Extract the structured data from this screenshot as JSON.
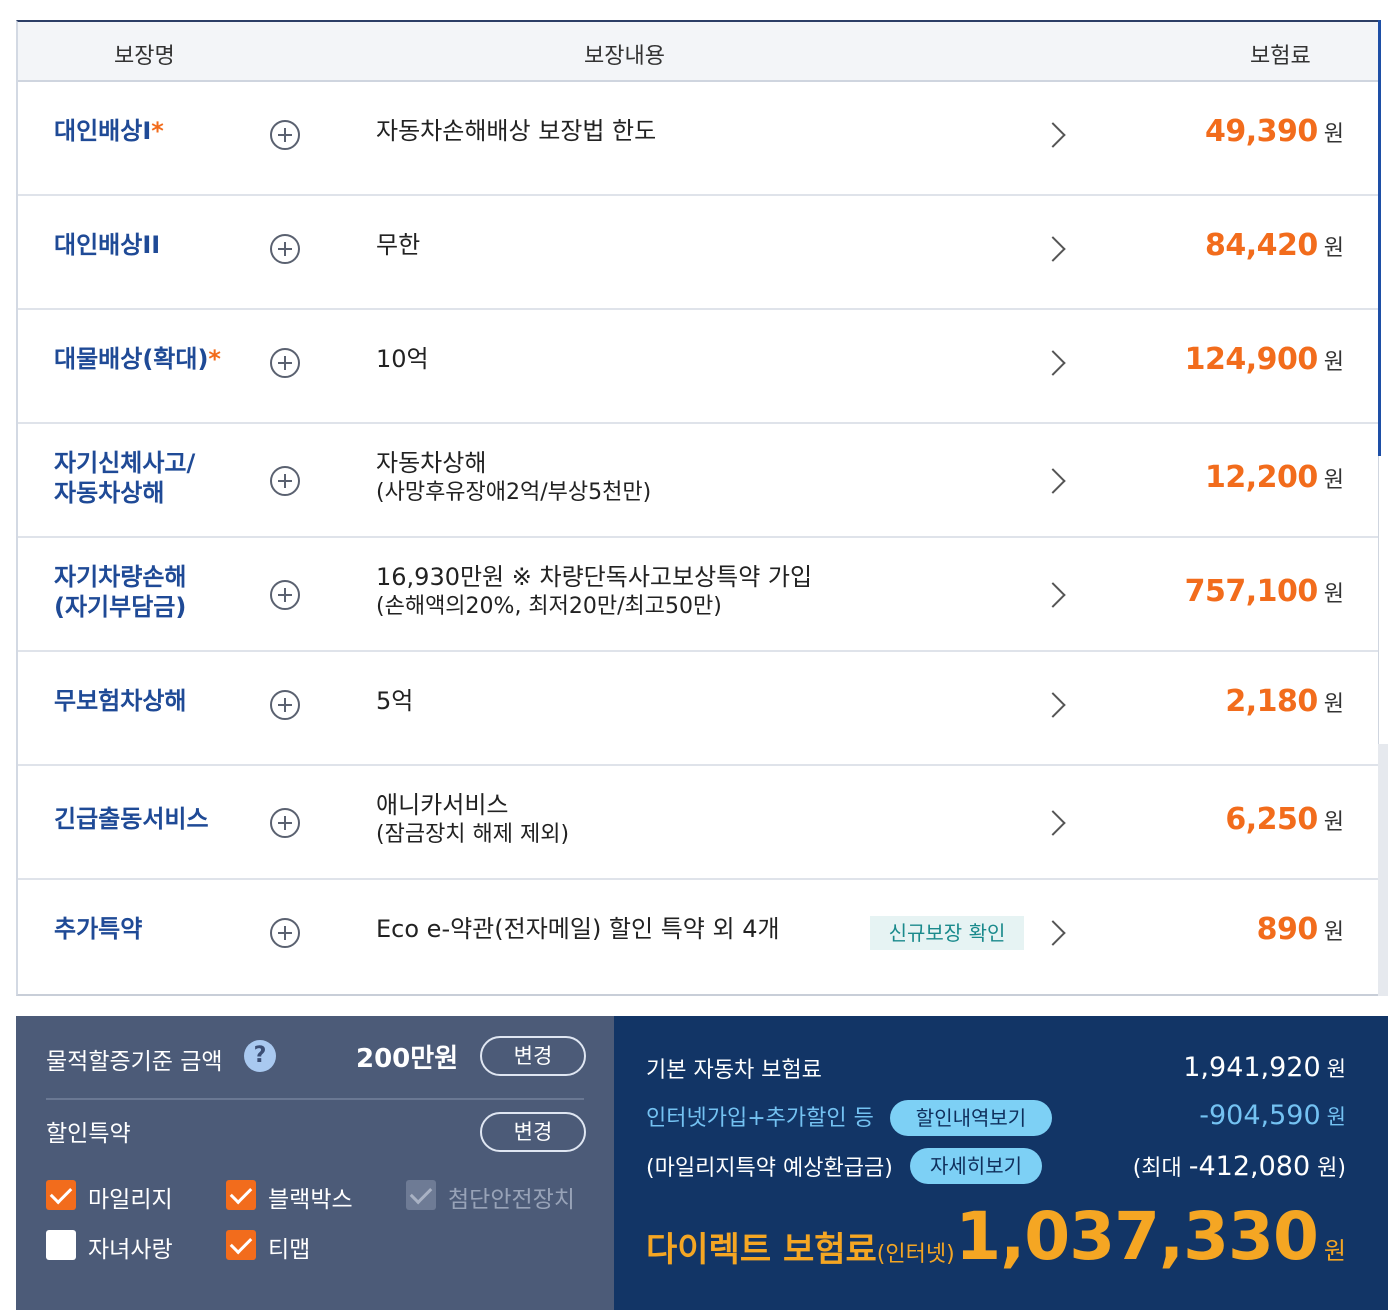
{
  "table": {
    "headers": {
      "name": "보장명",
      "content": "보장내용",
      "price": "보험료"
    },
    "rows": [
      {
        "name": "대인배상I",
        "star": "*",
        "content": "자동차손해배상 보장법 한도",
        "sub": "",
        "badge": "",
        "price": "49,390",
        "unit": "원"
      },
      {
        "name": "대인배상II",
        "star": "",
        "content": "무한",
        "sub": "",
        "badge": "",
        "price": "84,420",
        "unit": "원"
      },
      {
        "name": "대물배상(확대)",
        "star": "*",
        "content": "10억",
        "sub": "",
        "badge": "",
        "price": "124,900",
        "unit": "원"
      },
      {
        "name": "자기신체사고/",
        "name2": "자동차상해",
        "star": "",
        "content": "자동차상해",
        "sub": "(사망후유장애2억/부상5천만)",
        "badge": "",
        "price": "12,200",
        "unit": "원"
      },
      {
        "name": "자기차량손해",
        "name2": "(자기부담금)",
        "star": "",
        "content": "16,930만원 ※ 차량단독사고보상특약 가입",
        "sub": "(손해액의20%, 최저20만/최고50만)",
        "badge": "",
        "price": "757,100",
        "unit": "원"
      },
      {
        "name": "무보험차상해",
        "star": "",
        "content": "5억",
        "sub": "",
        "badge": "",
        "price": "2,180",
        "unit": "원"
      },
      {
        "name": "긴급출동서비스",
        "star": "",
        "content": "애니카서비스",
        "sub": "(잠금장치 해제 제외)",
        "badge": "",
        "price": "6,250",
        "unit": "원"
      },
      {
        "name": "추가특약",
        "star": "",
        "content": "Eco e-약관(전자메일) 할인 특약 외 4개",
        "sub": "",
        "badge": "신규보장 확인",
        "price": "890",
        "unit": "원"
      }
    ]
  },
  "left_panel": {
    "threshold_label": "물적할증기준 금액",
    "help_icon": "?",
    "threshold_value": "200만원",
    "change_label": "변경",
    "discount_label": "할인특약",
    "checkboxes": [
      {
        "label": "마일리지",
        "state": "checked"
      },
      {
        "label": "블랙박스",
        "state": "checked"
      },
      {
        "label": "첨단안전장치",
        "state": "disabled"
      },
      {
        "label": "자녀사랑",
        "state": "unchecked"
      },
      {
        "label": "티맵",
        "state": "checked"
      }
    ]
  },
  "right_panel": {
    "base_label": "기본 자동차 보험료",
    "base_value": "1,941,920",
    "discount_label": "인터넷가입+추가할인 등",
    "discount_pill": "할인내역보기",
    "discount_value": "-904,590",
    "refund_label": "(마일리지특약 예상환급금)",
    "refund_pill": "자세히보기",
    "refund_prefix": "(최대 ",
    "refund_value": "-412,080",
    "refund_suffix": " 원)",
    "direct_label": "다이렉트 보험료",
    "direct_small": "(인터넷)",
    "direct_value": "1,037,330",
    "unit": "원"
  },
  "colors": {
    "accent_orange": "#f26c1c",
    "name_blue": "#1f4a96",
    "panel_left": "#4c5b78",
    "panel_right": "#123566",
    "total_gold": "#f5a623"
  }
}
